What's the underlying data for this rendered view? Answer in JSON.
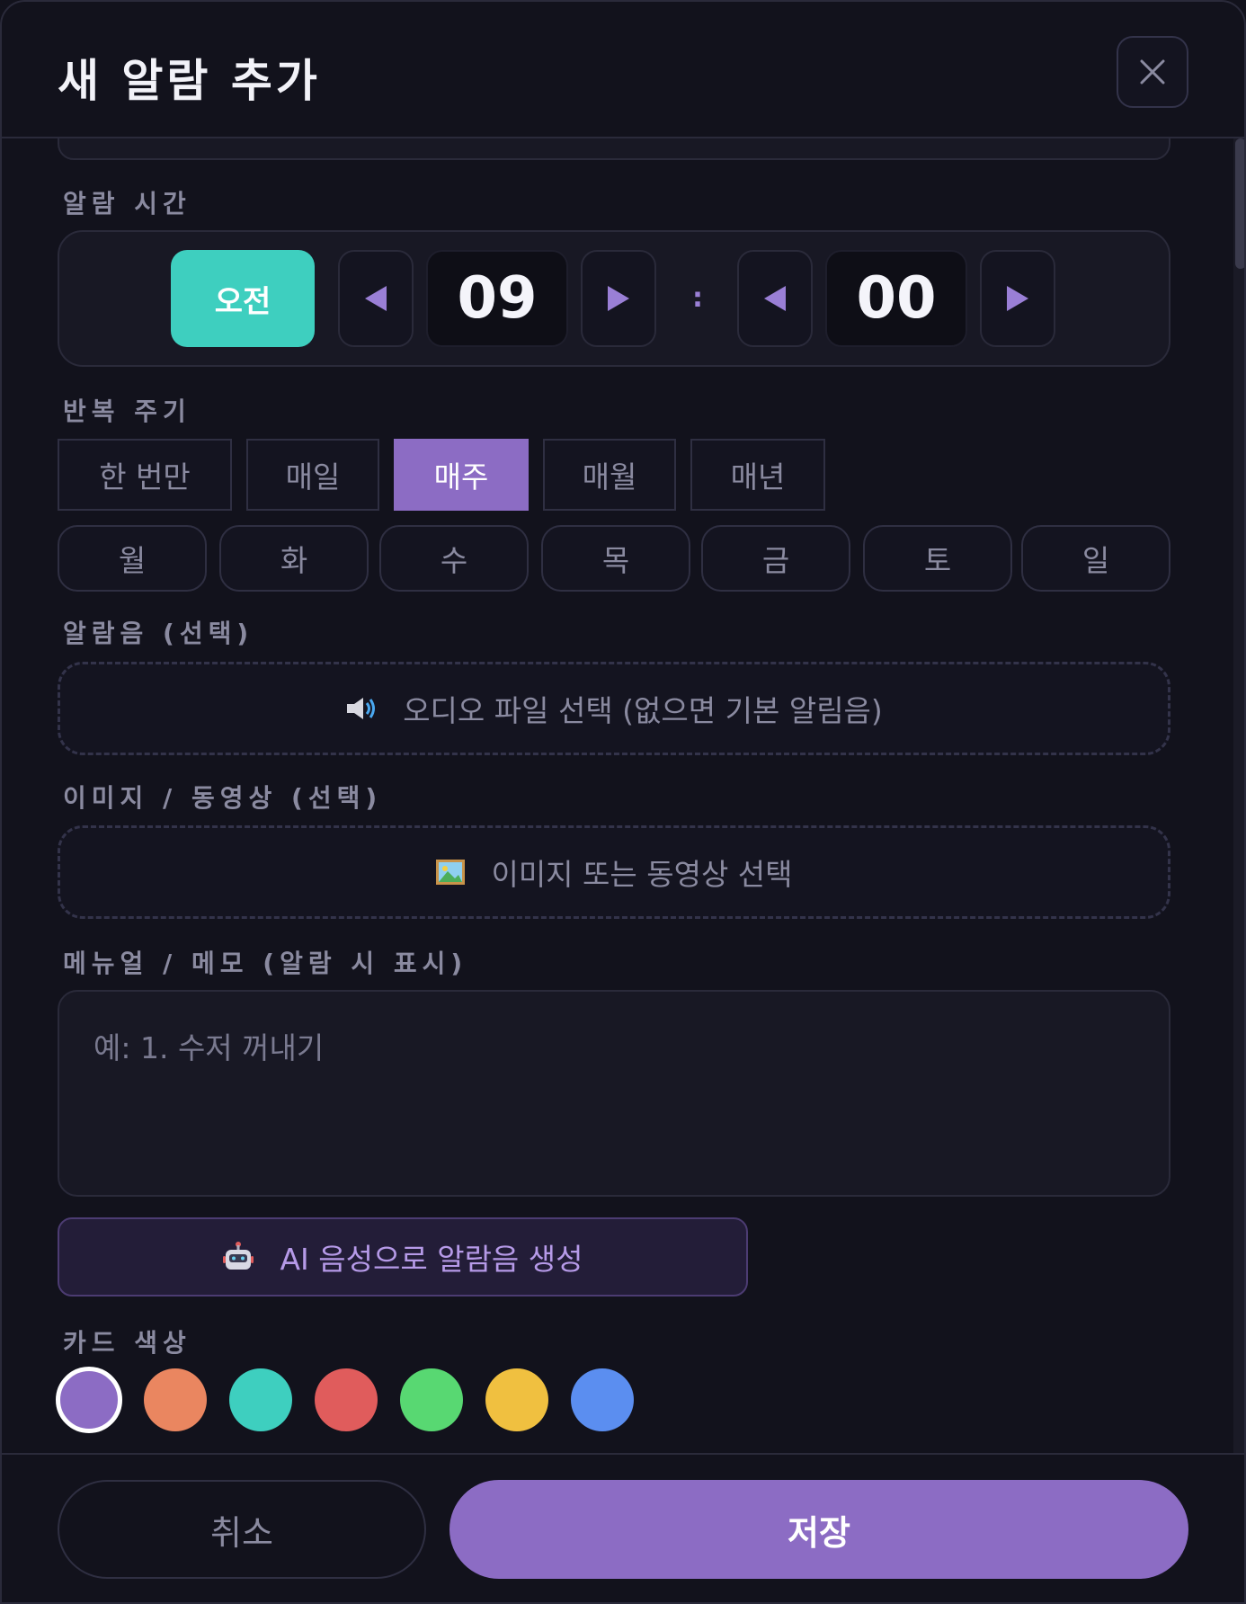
{
  "header": {
    "title": "새 알람 추가"
  },
  "time": {
    "label": "알람 시간",
    "ampm": "오전",
    "hour": "09",
    "separator": ":",
    "minute": "00"
  },
  "repeat": {
    "label": "반복 주기",
    "options": [
      "한 번만",
      "매일",
      "매주",
      "매월",
      "매년"
    ],
    "selected": "매주"
  },
  "days": [
    "월",
    "화",
    "수",
    "목",
    "금",
    "토",
    "일"
  ],
  "sound": {
    "label": "알람음 (선택)",
    "button": "오디오 파일 선택 (없으면 기본 알림음)"
  },
  "media": {
    "label": "이미지 / 동영상 (선택)",
    "button": "이미지 또는 동영상 선택"
  },
  "memo": {
    "label": "메뉴얼 / 메모 (알람 시 표시)",
    "placeholder": "예: 1. 수저 꺼내기"
  },
  "ai": {
    "button": "AI 음성으로 알람음 생성"
  },
  "card_color": {
    "label": "카드 색상",
    "colors": [
      "#8c6cc4",
      "#ea8660",
      "#3ecfbf",
      "#e05c5c",
      "#58d872",
      "#f0c040",
      "#5b8ef0"
    ],
    "selected_index": 0
  },
  "footer": {
    "cancel": "취소",
    "save": "저장"
  }
}
